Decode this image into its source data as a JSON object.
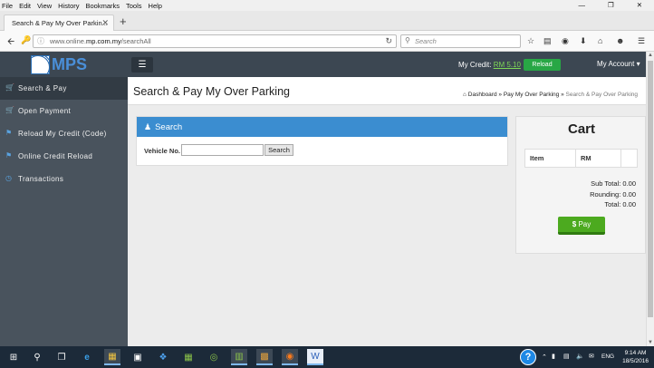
{
  "browser": {
    "menu": [
      "File",
      "Edit",
      "View",
      "History",
      "Bookmarks",
      "Tools",
      "Help"
    ],
    "tab_title": "Search & Pay My Over Parkin...",
    "url_prefix": "www.online.",
    "url_domain": "mp.com.my",
    "url_path": "/searchAll",
    "search_placeholder": "Search"
  },
  "header": {
    "logo_text": "MPS",
    "credit_label": "My Credit:",
    "credit_value": "RM 5.10",
    "reload_label": "Reload",
    "account_label": "My Account"
  },
  "sidebar": {
    "items": [
      {
        "label": "Search & Pay",
        "icon": "cart-icon"
      },
      {
        "label": "Open Payment",
        "icon": "cart-icon"
      },
      {
        "label": "Reload My Credit (Code)",
        "icon": "tag-icon"
      },
      {
        "label": "Online Credit Reload",
        "icon": "tag-icon"
      },
      {
        "label": "Transactions",
        "icon": "clock-icon"
      }
    ]
  },
  "main": {
    "title": "Search & Pay My Over Parking",
    "breadcrumb": [
      "Dashboard",
      "Pay My Over Parking",
      "Search & Pay Over Parking"
    ],
    "search_panel": {
      "heading": "Search",
      "vehicle_label": "Vehicle No.",
      "vehicle_value": "",
      "search_button": "Search"
    },
    "cart": {
      "title": "Cart",
      "columns": [
        "Item",
        "RM",
        ""
      ],
      "sub_total_label": "Sub Total:",
      "sub_total": "0.00",
      "rounding_label": "Rounding:",
      "rounding": "0.00",
      "total_label": "Total:",
      "total": "0.00",
      "pay_label": "Pay"
    }
  },
  "taskbar": {
    "language": "ENG",
    "time": "9:14 AM",
    "date": "18/5/2016"
  },
  "colors": {
    "topbar": "#3c4752",
    "sidebar": "#49535d",
    "panel_head": "#3b8dd0",
    "reload_button": "#28a745",
    "pay_button": "#4caa1f"
  }
}
